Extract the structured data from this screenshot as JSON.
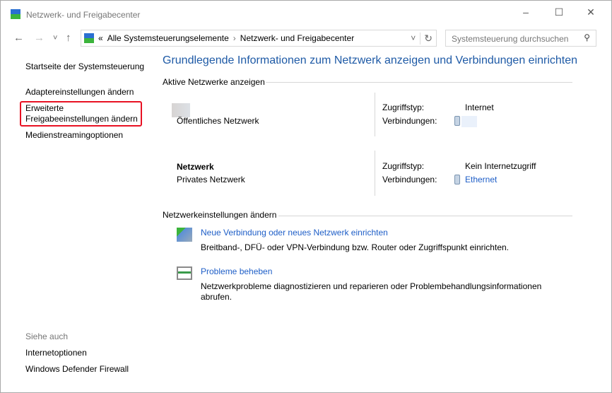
{
  "window": {
    "title": "Netzwerk- und Freigabecenter",
    "minimize": "–",
    "maximize": "☐",
    "close": "✕"
  },
  "nav": {
    "back": "←",
    "forward": "→",
    "recent": "˅",
    "up": "↑",
    "refresh": "↻",
    "dropdown": "˅"
  },
  "address": {
    "prefix": "«",
    "crumbs": [
      "Alle Systemsteuerungselemente",
      "Netzwerk- und Freigabecenter"
    ],
    "sep": "›"
  },
  "search": {
    "placeholder": "Systemsteuerung durchsuchen",
    "icon": "⚲"
  },
  "sidebar": {
    "items": [
      "Startseite der Systemsteuerung",
      "Adaptereinstellungen ändern",
      "Erweiterte Freigabeeinstellungen ändern",
      "Medienstreamingoptionen"
    ],
    "see_also": "Siehe auch",
    "links": [
      "Internetoptionen",
      "Windows Defender Firewall"
    ]
  },
  "main": {
    "heading": "Grundlegende Informationen zum Netzwerk anzeigen und Verbindungen einrichten",
    "active_title": "Aktive Netzwerke anzeigen",
    "networks": [
      {
        "name": "",
        "type": "Öffentliches Netzwerk",
        "access_label": "Zugriffstyp:",
        "access": "Internet",
        "conn_label": "Verbindungen:",
        "conn": ""
      },
      {
        "name": "Netzwerk",
        "type": "Privates Netzwerk",
        "access_label": "Zugriffstyp:",
        "access": "Kein Internetzugriff",
        "conn_label": "Verbindungen:",
        "conn": "Ethernet"
      }
    ],
    "change_title": "Netzwerkeinstellungen ändern",
    "tasks": [
      {
        "link": "Neue Verbindung oder neues Netzwerk einrichten",
        "desc": "Breitband-, DFÜ- oder VPN-Verbindung bzw. Router oder Zugriffspunkt einrichten."
      },
      {
        "link": "Probleme beheben",
        "desc": "Netzwerkprobleme diagnostizieren und reparieren oder Problembehandlungsinformationen abrufen."
      }
    ]
  },
  "colors": {
    "link": "#1e5ec7",
    "heading": "#1e5aa6",
    "highlight": "#e81123"
  }
}
